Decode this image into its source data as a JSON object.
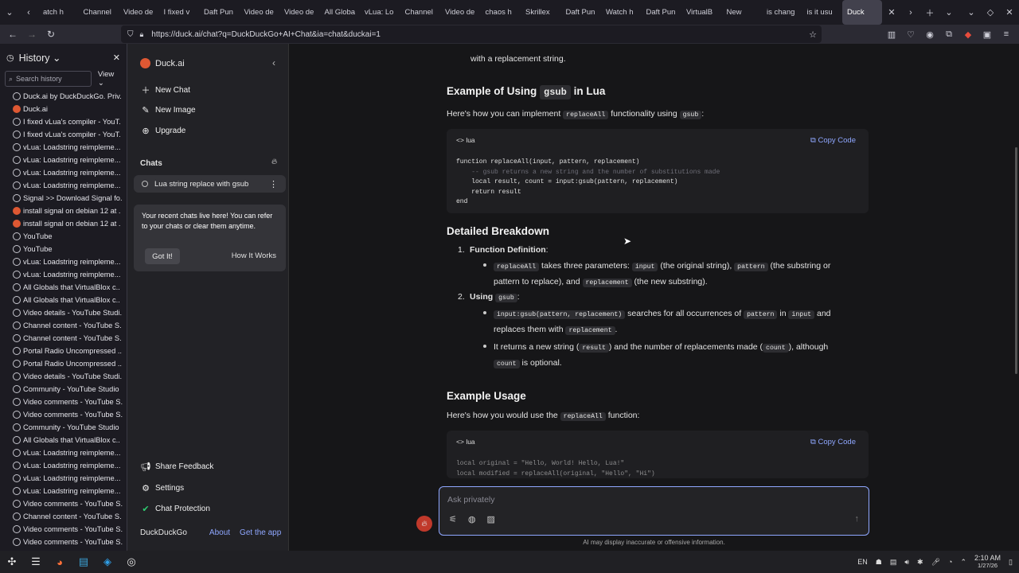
{
  "browser": {
    "tabs": [
      "atch h",
      "Channel",
      "Video de",
      "I fixed v",
      "Daft Pun",
      "Video de",
      "Video de",
      "All Globa",
      "vLua: Lo",
      "Channel",
      "Video de",
      "chaos h",
      "Skrillex",
      "Daft Pun",
      "Watch h",
      "Daft Pun",
      "VirtualB",
      "New",
      "is chang",
      "is it usu",
      "Duck"
    ],
    "url": "https://duck.ai/chat?q=DuckDuckGo+AI+Chat&ia=chat&duckai=1"
  },
  "history": {
    "title": "History",
    "search_placeholder": "Search history",
    "view_label": "View",
    "items": [
      {
        "label": "Duck.ai by DuckDuckGo. Priv.",
        "icon": "globe-icon"
      },
      {
        "label": "Duck.ai",
        "icon": "ddg-icon"
      },
      {
        "label": "I fixed vLua's compiler - YouT.",
        "icon": "globe-icon"
      },
      {
        "label": "I fixed vLua's compiler - YouT.",
        "icon": "globe-icon"
      },
      {
        "label": "vLua: Loadstring reimpleme...",
        "icon": "globe-icon"
      },
      {
        "label": "vLua: Loadstring reimpleme...",
        "icon": "globe-icon"
      },
      {
        "label": "vLua: Loadstring reimpleme...",
        "icon": "globe-icon"
      },
      {
        "label": "vLua: Loadstring reimpleme...",
        "icon": "globe-icon"
      },
      {
        "label": "Signal >> Download Signal fo.",
        "icon": "globe-icon"
      },
      {
        "label": "install signal on debian 12 at .",
        "icon": "ddg-icon"
      },
      {
        "label": "install signal on debian 12 at .",
        "icon": "ddg-icon"
      },
      {
        "label": "YouTube",
        "icon": "globe-icon"
      },
      {
        "label": "YouTube",
        "icon": "globe-icon"
      },
      {
        "label": "vLua: Loadstring reimpleme...",
        "icon": "globe-icon"
      },
      {
        "label": "vLua: Loadstring reimpleme...",
        "icon": "globe-icon"
      },
      {
        "label": "All Globals that VirtualBlox c..",
        "icon": "globe-icon"
      },
      {
        "label": "All Globals that VirtualBlox c..",
        "icon": "globe-icon"
      },
      {
        "label": "Video details - YouTube Studi.",
        "icon": "globe-icon"
      },
      {
        "label": "Channel content - YouTube S.",
        "icon": "globe-icon"
      },
      {
        "label": "Channel content - YouTube S.",
        "icon": "globe-icon"
      },
      {
        "label": "Portal Radio Uncompressed ..",
        "icon": "globe-icon"
      },
      {
        "label": "Portal Radio Uncompressed ..",
        "icon": "globe-icon"
      },
      {
        "label": "Video details - YouTube Studi.",
        "icon": "globe-icon"
      },
      {
        "label": "Community - YouTube Studio",
        "icon": "globe-icon"
      },
      {
        "label": "Video comments - YouTube S.",
        "icon": "globe-icon"
      },
      {
        "label": "Video comments - YouTube S.",
        "icon": "globe-icon"
      },
      {
        "label": "Community - YouTube Studio",
        "icon": "globe-icon"
      },
      {
        "label": "All Globals that VirtualBlox c..",
        "icon": "globe-icon"
      },
      {
        "label": "vLua: Loadstring reimpleme...",
        "icon": "globe-icon"
      },
      {
        "label": "vLua: Loadstring reimpleme...",
        "icon": "globe-icon"
      },
      {
        "label": "vLua: Loadstring reimpleme...",
        "icon": "globe-icon"
      },
      {
        "label": "vLua: Loadstring reimpleme...",
        "icon": "globe-icon"
      },
      {
        "label": "Video comments - YouTube S.",
        "icon": "globe-icon"
      },
      {
        "label": "Channel content - YouTube S.",
        "icon": "globe-icon"
      },
      {
        "label": "Video comments - YouTube S.",
        "icon": "globe-icon"
      },
      {
        "label": "Video comments - YouTube S.",
        "icon": "globe-icon"
      }
    ]
  },
  "duckai": {
    "brand": "Duck.ai",
    "new_chat": "New Chat",
    "new_image": "New Image",
    "upgrade": "Upgrade",
    "chats_label": "Chats",
    "chat_title": "Lua string replace with gsub",
    "tip_text": "Your recent chats live here! You can refer to your chats or clear them anytime.",
    "got_it": "Got It!",
    "how_it_works": "How It Works",
    "share_feedback": "Share Feedback",
    "settings": "Settings",
    "chat_protection": "Chat Protection",
    "footer_brand": "DuckDuckGo",
    "about": "About",
    "get_app": "Get the app"
  },
  "answer": {
    "top_line": "with a replacement string.",
    "h_example": [
      "Example of Using ",
      "gsub",
      " in Lua"
    ],
    "intro": [
      "Here's how you can implement ",
      "replaceAll",
      " functionality using ",
      "gsub",
      ":"
    ],
    "lang": "lua",
    "copy": "Copy Code",
    "code1": [
      "function replaceAll(input, pattern, replacement)",
      "    -- gsub returns a new string and the number of substitutions made",
      "    local result, count = input:gsub(pattern, replacement)",
      "    return result",
      "end"
    ],
    "h_breakdown": "Detailed Breakdown",
    "item1_num": "1.",
    "item1_title": "Function Definition",
    "item1_colon": ":",
    "item1_b": [
      "replaceAll",
      " takes three parameters: ",
      "input",
      " (the original string), ",
      "pattern",
      " (the substring or",
      "pattern to replace), and ",
      "replacement",
      " (the new substring)."
    ],
    "item2_num": "2.",
    "item2_title": "Using ",
    "item2_code": "gsub",
    "item2_colon": ":",
    "item2_b1": [
      "input:gsub(pattern, replacement)",
      " searches for all occurrences of ",
      "pattern",
      " in ",
      "input",
      " and",
      "replaces them with ",
      "replacement",
      "."
    ],
    "item2_b2": [
      "It returns a new string (",
      "result",
      ") and the number of replacements made (",
      "count",
      "), although",
      "count",
      " is optional."
    ],
    "h_usage": "Example Usage",
    "usage_intro": [
      "Here's how you would use the ",
      "replaceAll",
      " function:"
    ],
    "code2": [
      "local original = \"Hello, World! Hello, Lua!\"",
      "local modified = replaceAll(original, \"Hello\", \"Hi\")"
    ],
    "input_placeholder": "Ask privately",
    "disclaimer": "AI may display inaccurate or offensive information."
  },
  "taskbar": {
    "lang": "EN",
    "time": "2:10 AM",
    "date": "1/27/26"
  },
  "colors": {
    "accent": "#8fa7ff",
    "brand": "#de5833"
  }
}
